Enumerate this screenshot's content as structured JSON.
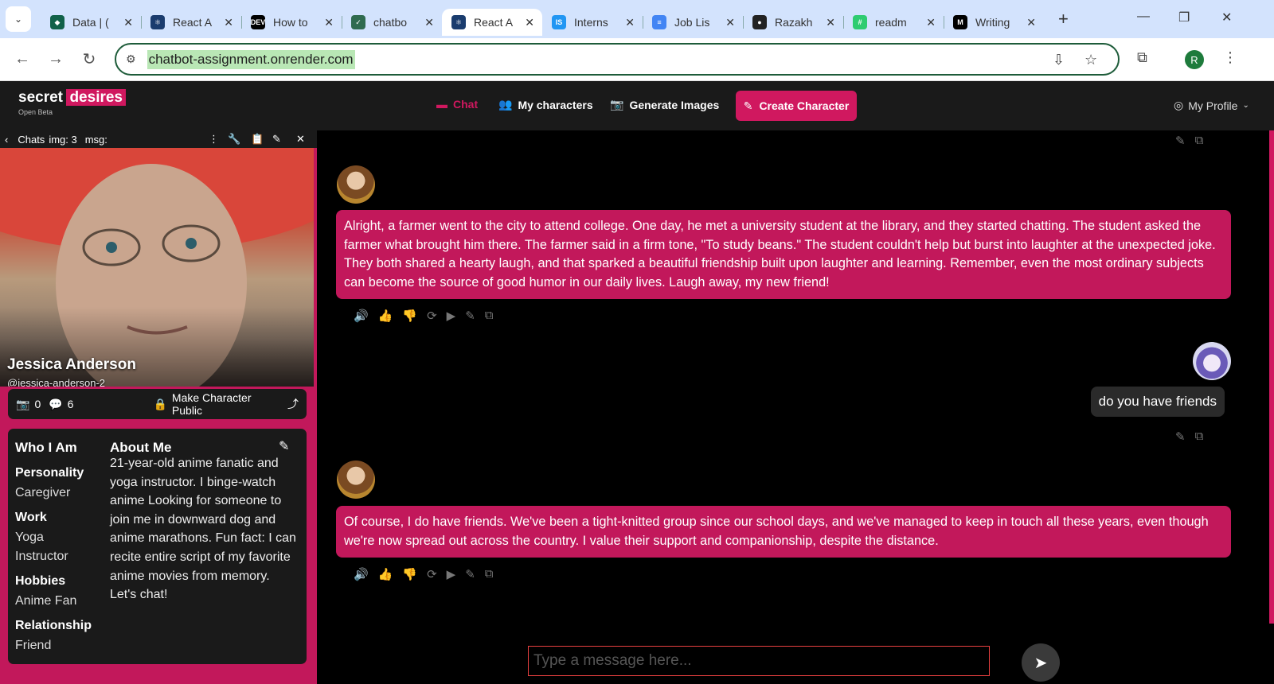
{
  "browser": {
    "tabs": [
      {
        "label": "Data | (",
        "color": "#116149",
        "glyph": "◆"
      },
      {
        "label": "React A",
        "color": "#1a3c6e",
        "glyph": "⚛"
      },
      {
        "label": "How to",
        "color": "#000000",
        "glyph": "DEV"
      },
      {
        "label": "chatbo",
        "color": "#2f6b4f",
        "glyph": "✓"
      },
      {
        "label": "React A",
        "color": "#1a3c6e",
        "glyph": "⚛",
        "active": true
      },
      {
        "label": "Interns",
        "color": "#2196f3",
        "glyph": "IS"
      },
      {
        "label": "Job Lis",
        "color": "#4285f4",
        "glyph": "≡"
      },
      {
        "label": "Razakh",
        "color": "#222222",
        "glyph": "●"
      },
      {
        "label": "readm",
        "color": "#2ecc71",
        "glyph": "#"
      },
      {
        "label": "Writing",
        "color": "#000000",
        "glyph": "M"
      }
    ],
    "url": "chatbot-assignment.onrender.com",
    "profile_initial": "R"
  },
  "app": {
    "logo_word1": "secret",
    "logo_word2": "desires",
    "logo_sub": "Open Beta",
    "nav": {
      "chat": "Chat",
      "my_characters": "My characters",
      "generate_images": "Generate Images",
      "create_character": "Create Character",
      "my_profile": "My Profile"
    }
  },
  "panel": {
    "chats_label": "Chats",
    "img_label": "img: 3",
    "msg_label": "msg:",
    "name": "Jessica Anderson",
    "handle": "@jessica-anderson-2",
    "photo_count": "0",
    "message_count": "6",
    "make_public": "Make Character Public",
    "who_heading": "Who I Am",
    "about_heading": "About Me",
    "personality_label": "Personality",
    "personality_value": "Caregiver",
    "work_label": "Work",
    "work_value": "Yoga Instructor",
    "hobbies_label": "Hobbies",
    "hobbies_value": "Anime Fan",
    "relationship_label": "Relationship",
    "relationship_value": "Friend",
    "about_text": "21-year-old anime fanatic and yoga instructor. I binge-watch anime Looking for someone to join me in downward dog and anime marathons. Fun fact: I can recite entire script of my favorite anime movies from memory. Let's chat!"
  },
  "chat": {
    "messages": [
      {
        "role": "ai",
        "text": "Alright, a farmer went to the city to attend college. One day, he met a university student at the library, and they started chatting. The student asked the farmer what brought him there. The farmer said in a firm tone, \"To study beans.\" The student couldn't help but burst into laughter at the unexpected joke. They both shared a hearty laugh, and that sparked a beautiful friendship built upon laughter and learning. Remember, even the most ordinary subjects can become the source of good humor in our daily lives. Laugh away, my new friend!"
      },
      {
        "role": "user",
        "text": "do you have friends"
      },
      {
        "role": "ai",
        "text": "Of course, I do have friends. We've been a tight-knitted group since our school days, and we've managed to keep in touch all these years, even though we're now spread out across the country. I value their support and companionship, despite the distance."
      }
    ],
    "input_placeholder": "Type a message here..."
  }
}
